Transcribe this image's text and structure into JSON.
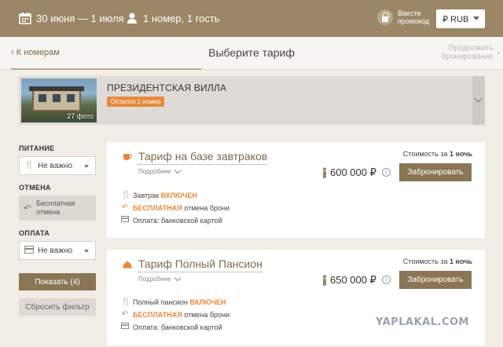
{
  "header": {
    "dates": "30 июня — 1 июля",
    "guests": "1 номер, 1 гость",
    "promo_line1": "Ввести",
    "promo_line2": "промокод",
    "currency": "₽ RUB"
  },
  "nav": {
    "back": "‹ К номерам",
    "title": "Выберите тариф",
    "next_line1": "Продолжить",
    "next_line2": "бронирование"
  },
  "villa": {
    "name": "ПРЕЗИДЕНТСКАЯ ВИЛЛА",
    "badge": "Остался 1 номер",
    "photo_count": "27 фото"
  },
  "filters": {
    "meal_label": "ПИТАНИЕ",
    "meal_value": "Не важно",
    "cancel_label": "ОТМЕНА",
    "cancel_line1": "Бесплатная",
    "cancel_line2": "отмена",
    "payment_label": "ОПЛАТА",
    "payment_value": "Не важно",
    "show_button": "Показать (4)",
    "reset_button": "Сбросить фильтр"
  },
  "tariffs": [
    {
      "name": "Тариф на базе завтраков",
      "more": "Подробнее",
      "cost_prefix": "Стоимость за",
      "cost_period": "1 ночь",
      "price": "600 000 ₽",
      "book": "Забронировать",
      "meal_text": "Завтрак",
      "meal_hl": "ВКЛЮЧЕН",
      "cancel_hl": "БЕСПЛАТНАЯ",
      "cancel_text": "отмена брони",
      "payment": "Оплата: банковской картой"
    },
    {
      "name": "Тариф Полный Пансион",
      "more": "Подробнее",
      "cost_prefix": "Стоимость за",
      "cost_period": "1 ночь",
      "price": "650 000 ₽",
      "book": "Забронировать",
      "meal_text": "Полный пансион",
      "meal_hl": "ВКЛЮЧЕН",
      "cancel_hl": "БЕСПЛАТНАЯ",
      "cancel_text": "отмена брони",
      "payment": "Оплата: банковской картой"
    }
  ],
  "watermark": "YAPLAKAL.COM",
  "colors": {
    "header_bg": "#9b8766",
    "accent_orange": "#e5893a",
    "button_brown": "#8a7555",
    "page_bg": "#f1ede6"
  }
}
